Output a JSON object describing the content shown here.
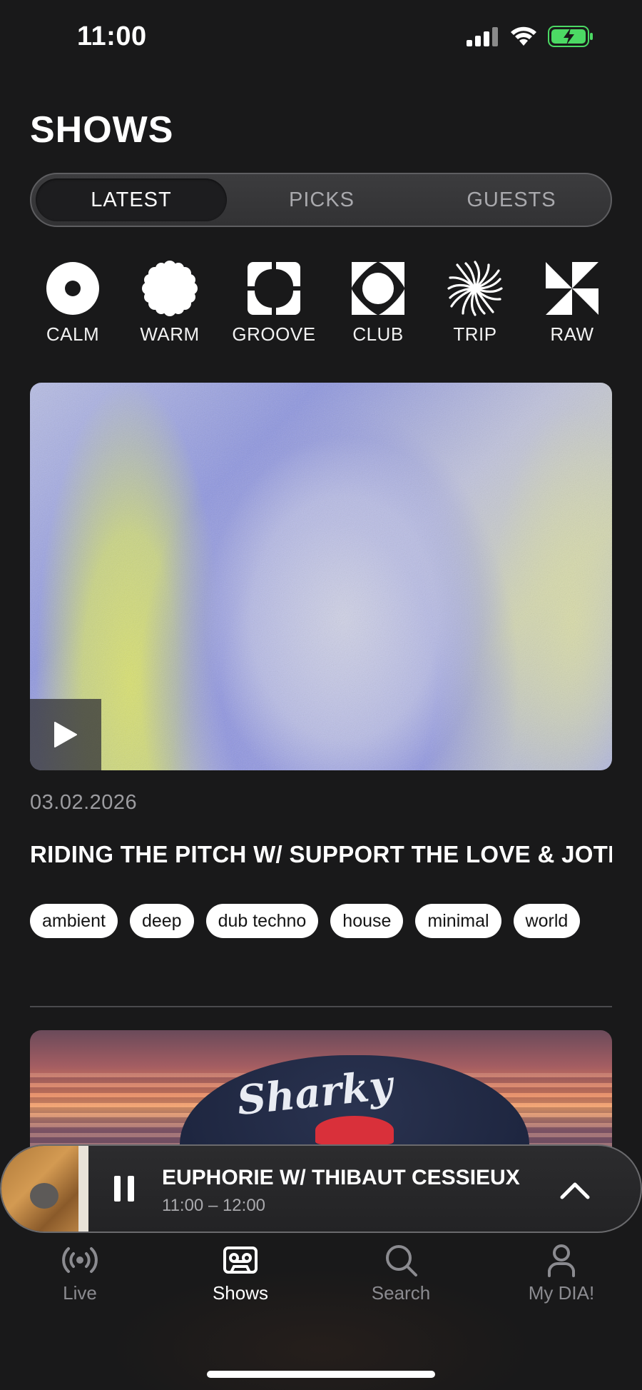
{
  "status_bar": {
    "time": "11:00"
  },
  "page": {
    "title": "SHOWS"
  },
  "tabs": [
    {
      "label": "LATEST",
      "active": true
    },
    {
      "label": "PICKS",
      "active": false
    },
    {
      "label": "GUESTS",
      "active": false
    }
  ],
  "moods": [
    {
      "label": "CALM",
      "icon": "calm-icon"
    },
    {
      "label": "WARM",
      "icon": "warm-icon"
    },
    {
      "label": "GROOVE",
      "icon": "groove-icon"
    },
    {
      "label": "CLUB",
      "icon": "club-icon"
    },
    {
      "label": "TRIP",
      "icon": "trip-icon"
    },
    {
      "label": "RAW",
      "icon": "raw-icon"
    }
  ],
  "show": {
    "date": "03.02.2026",
    "title": "RIDING THE PITCH W/ SUPPORT THE LOVE & JOTI",
    "tags": [
      "ambient",
      "deep",
      "dub techno",
      "house",
      "minimal",
      "world"
    ]
  },
  "next_card": {
    "cap_text": "Sharky"
  },
  "player": {
    "title": "EUPHORIE W/ THIBAUT CESSIEUX",
    "time": "11:00 – 12:00"
  },
  "nav": [
    {
      "label": "Live",
      "icon": "live-icon",
      "active": false
    },
    {
      "label": "Shows",
      "icon": "shows-icon",
      "active": true
    },
    {
      "label": "Search",
      "icon": "search-icon",
      "active": false
    },
    {
      "label": "My DIA!",
      "icon": "profile-icon",
      "active": false
    }
  ],
  "colors": {
    "background": "#19191a",
    "accent": "#ffffff",
    "battery": "#4cd964"
  }
}
